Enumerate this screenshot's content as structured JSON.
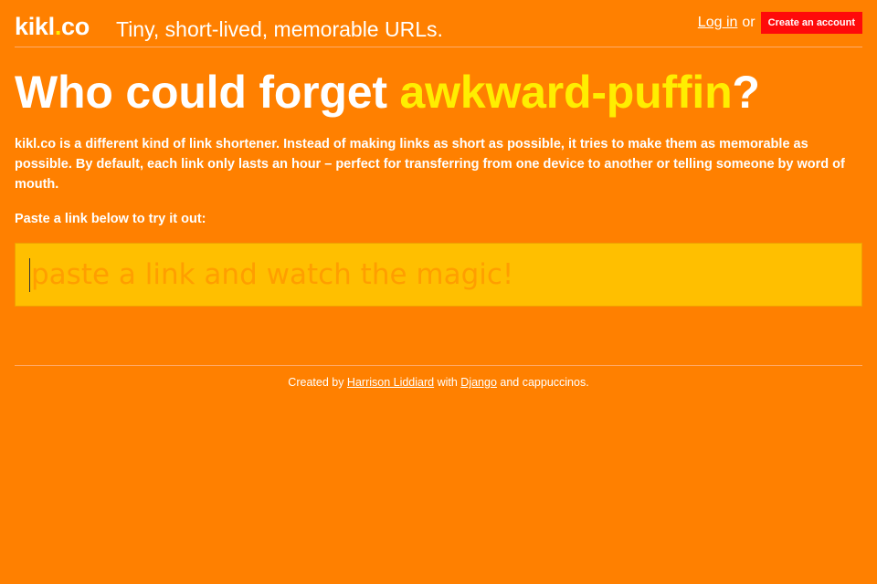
{
  "header": {
    "logo_main": "kikl",
    "logo_dot": ".",
    "logo_tld": "co",
    "tagline": "Tiny, short-lived, memorable URLs.",
    "login_label": "Log in",
    "or_text": "or",
    "create_account_label": "Create an account"
  },
  "hero": {
    "headline_prefix": "Who could forget ",
    "headline_slug": "awkward-puffin",
    "headline_suffix": "?",
    "description": "kikl.co is a different kind of link shortener. Instead of making links as short as possible, it tries to make them as memorable as possible. By default, each link only lasts an hour – perfect for transferring from one device to another or telling someone by word of mouth.",
    "prompt": "Paste a link below to try it out:"
  },
  "link_input": {
    "value": "",
    "placeholder": "paste a link and watch the magic!"
  },
  "footer": {
    "created_by": "Created by ",
    "author_link": "Harrison Liddiard",
    "with_text": " with ",
    "framework_link": "Django",
    "end_text": " and cappuccinos."
  },
  "colors": {
    "background": "#ff8000",
    "accent_yellow": "#ffee00",
    "input_background": "#ffbf00",
    "create_button": "#ff0a0a"
  }
}
